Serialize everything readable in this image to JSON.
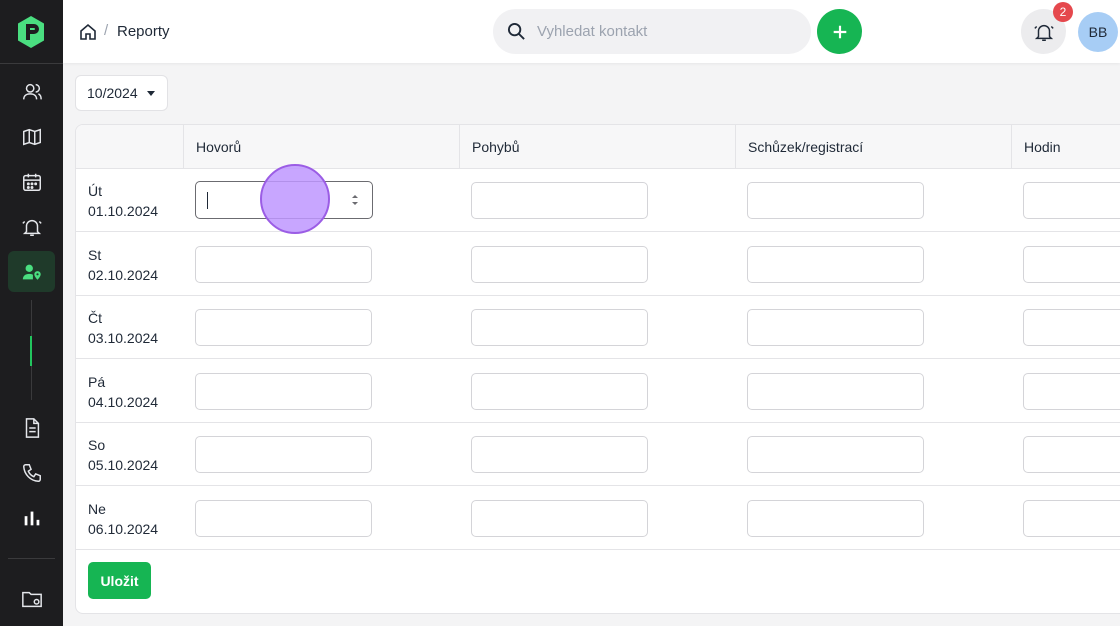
{
  "breadcrumb": {
    "current": "Reporty"
  },
  "search": {
    "placeholder": "Vyhledat kontakt"
  },
  "notifications": {
    "count": "2"
  },
  "user": {
    "initials": "BB"
  },
  "month_select": {
    "value": "10/2024"
  },
  "table": {
    "columns": [
      "",
      "Hovorů",
      "Pohybů",
      "Schůzek/registrací",
      "Hodin"
    ],
    "rows": [
      {
        "day": "Út",
        "date": "01.10.2024"
      },
      {
        "day": "St",
        "date": "02.10.2024"
      },
      {
        "day": "Čt",
        "date": "03.10.2024"
      },
      {
        "day": "Pá",
        "date": "04.10.2024"
      },
      {
        "day": "So",
        "date": "05.10.2024"
      },
      {
        "day": "Ne",
        "date": "06.10.2024"
      }
    ]
  },
  "actions": {
    "save_label": "Uložit"
  },
  "colors": {
    "accent": "#16b553",
    "sidebar": "#1d1d1f",
    "badge": "#e5484d"
  },
  "icons": {
    "sidebar": [
      "contacts-icon",
      "map-icon",
      "calendar-icon",
      "bell-alert-icon",
      "user-location-icon",
      "document-icon",
      "phone-icon",
      "bar-chart-icon",
      "folder-settings-icon"
    ]
  }
}
